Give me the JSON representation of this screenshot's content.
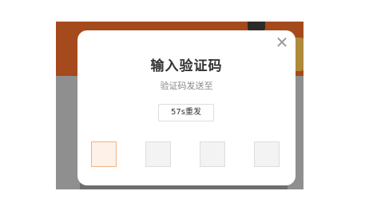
{
  "dialog": {
    "title": "输入验证码",
    "subtitle": "验证码发送至",
    "resend_label": "57s重发",
    "close_symbol": "✕",
    "code_length": 4,
    "active_index": 0,
    "accent_color": "#f2b284"
  }
}
